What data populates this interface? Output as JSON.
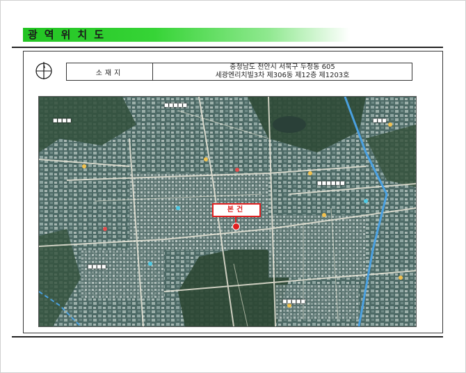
{
  "header": {
    "title": "광역위치도"
  },
  "info": {
    "label": "소재지",
    "address_line1": "충청남도 천안시 서북구 두정동 605",
    "address_line2": "세광엔리치빌3차 제306동 제12층 제1203호"
  },
  "map": {
    "marker_label": "본건"
  }
}
